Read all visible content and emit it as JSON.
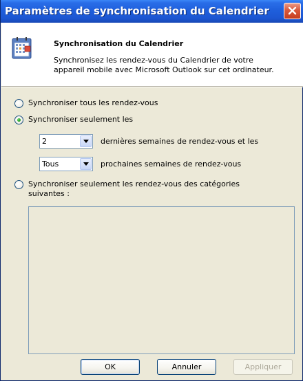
{
  "window": {
    "title": "Paramètres de synchronisation du Calendrier",
    "close_icon": "close-icon"
  },
  "header": {
    "icon": "calendar-icon",
    "title": "Synchronisation du Calendrier",
    "description": "Synchronisez les rendez-vous du Calendrier de votre appareil mobile avec Microsoft Outlook sur cet ordinateur."
  },
  "options": {
    "all": {
      "label": "Synchroniser tous les rendez-vous",
      "selected": false
    },
    "only": {
      "label": "Synchroniser seulement les",
      "selected": true
    },
    "past_weeks": {
      "value": "2",
      "label": "dernières semaines de rendez-vous et les"
    },
    "future_weeks": {
      "value": "Tous",
      "label": "prochaines semaines de rendez-vous"
    },
    "categories": {
      "label": "Synchroniser seulement les rendez-vous des catégories suivantes :",
      "selected": false
    }
  },
  "buttons": {
    "ok": "OK",
    "cancel": "Annuler",
    "apply": "Appliquer"
  },
  "colors": {
    "titlebar": "#1f5fdc",
    "dialog_bg": "#ece9d8",
    "radio_dot": "#21a121"
  }
}
